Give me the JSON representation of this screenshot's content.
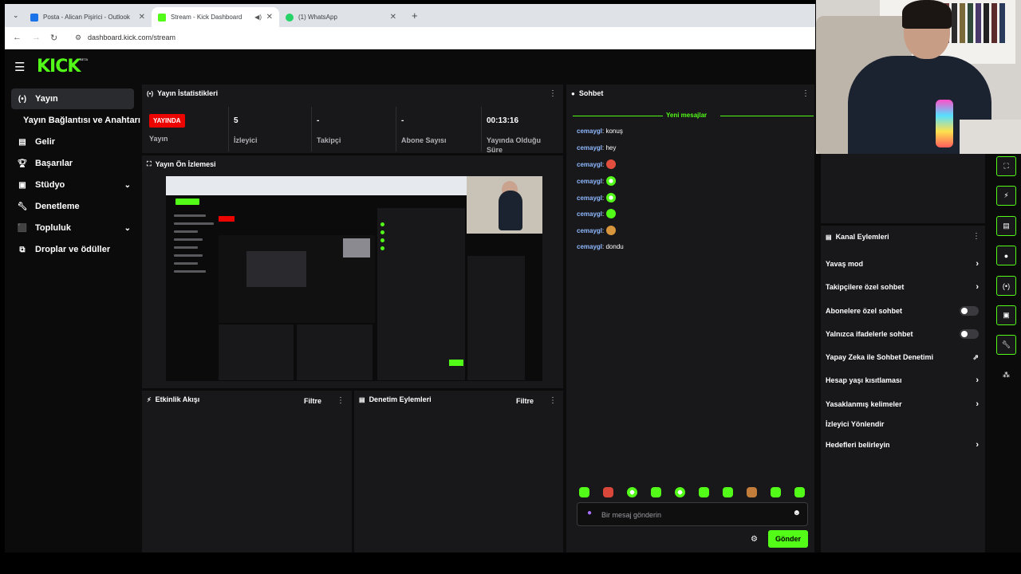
{
  "browser": {
    "tabs": [
      {
        "title": "Posta - Alican Pişirici - Outlook",
        "icon": "outlook-icon",
        "active": false
      },
      {
        "title": "Stream - Kick Dashboard",
        "icon": "kick-icon",
        "active": true
      },
      {
        "title": "(1) WhatsApp",
        "icon": "whatsapp-icon",
        "active": false
      }
    ],
    "url": "dashboard.kick.com/stream"
  },
  "app": {
    "logo": "KICK",
    "beta": "BETA",
    "accent": "#53fc18"
  },
  "sidebar": {
    "items": [
      {
        "label": "Yayın",
        "icon": "broadcast-icon",
        "active": true
      },
      {
        "label": "Yayın Bağlantısı ve Anahtarı",
        "icon": "",
        "active": false
      },
      {
        "label": "Gelir",
        "icon": "revenue-icon",
        "active": false
      },
      {
        "label": "Başarılar",
        "icon": "trophy-icon",
        "active": false
      },
      {
        "label": "Stüdyo",
        "icon": "studio-icon",
        "active": false,
        "expandable": true
      },
      {
        "label": "Denetleme",
        "icon": "wrench-icon",
        "active": false
      },
      {
        "label": "Topluluk",
        "icon": "community-icon",
        "active": false,
        "expandable": true
      },
      {
        "label": "Droplar ve ödüller",
        "icon": "drops-icon",
        "active": false
      }
    ]
  },
  "stats": {
    "title": "Yayın İstatistikleri",
    "live_badge": "YAYINDA",
    "live_label": "Yayın",
    "cells": [
      {
        "value": "5",
        "label": "İzleyici"
      },
      {
        "value": "-",
        "label": "Takipçi"
      },
      {
        "value": "-",
        "label": "Abone Sayısı"
      },
      {
        "value": "00:13:16",
        "label": "Yayında Olduğu Süre"
      }
    ]
  },
  "preview": {
    "title": "Yayın Ön İzlemesi"
  },
  "activity": {
    "title": "Etkinlik Akışı",
    "filter": "Filtre"
  },
  "moderation": {
    "title": "Denetim Eylemleri",
    "filter": "Filtre"
  },
  "chat": {
    "title": "Sohbet",
    "new_messages": "Yeni mesajlar",
    "messages": [
      {
        "user": "cemaygl",
        "text": "konuş",
        "emote": ""
      },
      {
        "user": "cemaygl",
        "text": "hey",
        "emote": ""
      },
      {
        "user": "cemaygl",
        "text": "",
        "emote": "red"
      },
      {
        "user": "cemaygl",
        "text": "",
        "emote": "half"
      },
      {
        "user": "cemaygl",
        "text": "",
        "emote": "half"
      },
      {
        "user": "cemaygl",
        "text": "",
        "emote": "green"
      },
      {
        "user": "cemaygl",
        "text": "",
        "emote": "burger"
      },
      {
        "user": "cemaygl",
        "text": "dondu",
        "emote": ""
      }
    ],
    "emote_bar": [
      "green",
      "red",
      "half",
      "green",
      "half",
      "green",
      "green",
      "burger",
      "green",
      "green"
    ],
    "input_placeholder": "Bir mesaj gönderin",
    "send_label": "Gönder"
  },
  "channel_actions": {
    "title": "Kanal Eylemleri",
    "rows": [
      {
        "label": "Yavaş mod",
        "control": "arrow"
      },
      {
        "label": "Takipçilere özel sohbet",
        "control": "arrow"
      },
      {
        "label": "Abonelere özel sohbet",
        "control": "toggle"
      },
      {
        "label": "Yalnızca ifadelerle sohbet",
        "control": "toggle"
      },
      {
        "label": "Yapay Zeka ile Sohbet Denetimi",
        "control": "external"
      },
      {
        "label": "Hesap yaşı kısıtlaması",
        "control": "arrow"
      },
      {
        "label": "Yasaklanmış kelimeler",
        "control": "arrow"
      },
      {
        "label": "İzleyici Yönlendir",
        "control": "none"
      },
      {
        "label": "Hedefleri belirleyin",
        "control": "arrow"
      }
    ]
  },
  "rail": [
    "fullscreen-icon",
    "bolt-icon",
    "notes-icon",
    "chat-icon",
    "broadcast-icon",
    "screen-icon",
    "wrench-icon",
    "share-icon"
  ]
}
